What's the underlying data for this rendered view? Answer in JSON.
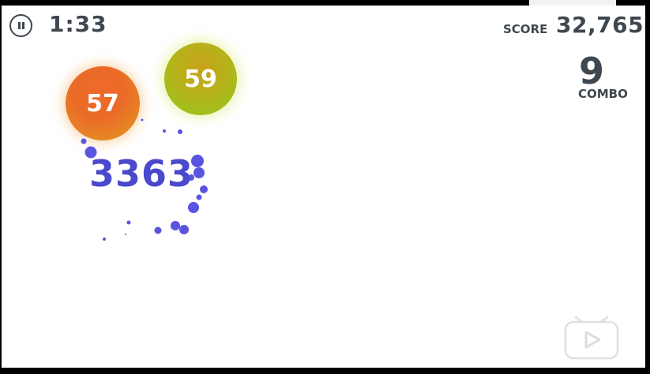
{
  "hud": {
    "timer": "1:33",
    "score_label": "SCORE",
    "score_value": "32,765",
    "combo_value": "9",
    "combo_label": "COMBO"
  },
  "bubbles": [
    {
      "value": "57",
      "color": "#ea6a28"
    },
    {
      "value": "59",
      "color": "#b6b21a"
    }
  ],
  "result_number": "3363",
  "colors": {
    "hud_text": "#3f4750",
    "result_text": "#4a48cc",
    "particle": "#5a55e0"
  },
  "icons": {
    "pause": "pause-icon",
    "replay": "play-icon"
  }
}
